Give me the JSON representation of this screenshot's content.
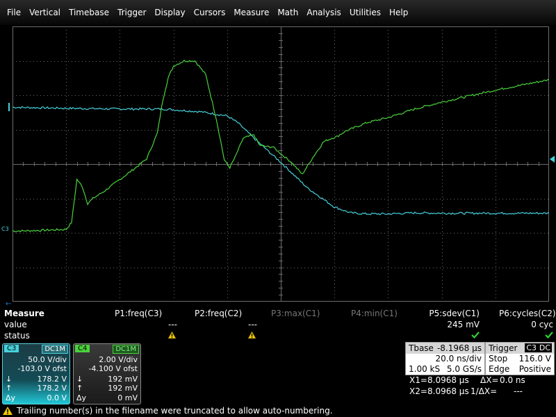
{
  "menu": [
    "File",
    "Vertical",
    "Timebase",
    "Trigger",
    "Display",
    "Cursors",
    "Measure",
    "Math",
    "Analysis",
    "Utilities",
    "Help"
  ],
  "colors": {
    "ch3": "#46d2dc",
    "ch4": "#4ad23c",
    "grid": "#6e6e6e",
    "accent_blue": "#1e78c8"
  },
  "markers": {
    "left_trace_label": "C3",
    "trigger_marker_icon": "triangle-left-icon",
    "time_marker_icon": "arrow-left-icon"
  },
  "measure": {
    "title": "Measure",
    "row_value": "value",
    "row_status": "status",
    "params": [
      {
        "label": "P1:freq(C3)",
        "value": "---",
        "status": "warning",
        "active": true
      },
      {
        "label": "P2:freq(C2)",
        "value": "---",
        "status": "warning",
        "active": true
      },
      {
        "label": "P3:max(C1)",
        "value": "",
        "status": "",
        "active": false
      },
      {
        "label": "P4:min(C1)",
        "value": "",
        "status": "",
        "active": false
      },
      {
        "label": "P5:sdev(C1)",
        "value": "245 mV",
        "status": "ok",
        "active": true
      },
      {
        "label": "P6:cycles(C2)",
        "value": "0 cyc",
        "status": "ok",
        "active": true
      }
    ]
  },
  "ch3": {
    "tag": "C3",
    "coupling": "DC1M",
    "scale": "50.0 V/div",
    "offset": "-103.0 V ofst",
    "down_sym": "↓",
    "down": "178.2 V",
    "up_sym": "↑",
    "up": "178.2 V",
    "dy_sym": "Δy",
    "dy": "0.0 V"
  },
  "ch4": {
    "tag": "C4",
    "coupling": "DC1M",
    "scale": "2.00 V/div",
    "offset": "-4.100 V ofst",
    "down_sym": "↓",
    "down": "192 mV",
    "up_sym": "↑",
    "up": "192 mV",
    "dy_sym": "Δy",
    "dy": "0 mV"
  },
  "timebase": {
    "label": "Tbase",
    "delay": "-8.1968 µs",
    "scale": "20.0 ns/div",
    "samples": "1.00 kS",
    "rate": "5.0 GS/s"
  },
  "trigger": {
    "label": "Trigger",
    "source": "C3",
    "coupling": "DC",
    "mode": "Stop",
    "level": "116.0 V",
    "type": "Edge",
    "slope": "Positive"
  },
  "cursors": {
    "x1_label": "X1=",
    "x1": "8.0968 µs",
    "dx_label": "ΔX=",
    "dx": "0.0 ns",
    "x2_label": "X2=",
    "x2": "8.0968 µs",
    "inv_label": "1/ΔX=",
    "inv": "---"
  },
  "status": {
    "message": "Trailing number(s) in the filename were truncated to allow auto-numbering."
  },
  "chart_data": {
    "type": "line",
    "grid": {
      "divisions_x": 10,
      "divisions_y": 8
    },
    "x_unit": "div",
    "y_unit": "div",
    "series": [
      {
        "name": "C3",
        "color": "#46d2dc",
        "x": [
          0,
          1,
          2,
          2.8,
          3.5,
          4.0,
          4.2,
          4.5,
          5.0,
          5.5,
          6.0,
          6.3,
          6.6,
          7.0,
          7.5,
          8.0,
          9.0,
          10.0
        ],
        "y": [
          1.65,
          1.62,
          1.6,
          1.6,
          1.52,
          1.4,
          1.2,
          0.75,
          0.05,
          -0.7,
          -1.25,
          -1.42,
          -1.45,
          -1.45,
          -1.42,
          -1.43,
          -1.43,
          -1.43
        ]
      },
      {
        "name": "C4",
        "color": "#4ad23c",
        "x": [
          0,
          0.5,
          1.0,
          1.1,
          1.2,
          1.3,
          1.4,
          1.5,
          1.7,
          2.0,
          2.3,
          2.5,
          2.7,
          2.8,
          2.9,
          3.0,
          3.2,
          3.4,
          3.6,
          3.8,
          3.95,
          4.05,
          4.15,
          4.3,
          4.5,
          4.6,
          4.75,
          4.85,
          5.0,
          5.2,
          5.4,
          5.6,
          5.8,
          5.95,
          6.05,
          6.2,
          6.6,
          7.0,
          7.5,
          8.0,
          9.0,
          10.0
        ],
        "y": [
          -1.95,
          -1.93,
          -1.9,
          -1.7,
          -0.45,
          -0.65,
          -1.15,
          -1.0,
          -0.8,
          -0.45,
          -0.1,
          0.15,
          0.9,
          1.85,
          2.5,
          2.85,
          3.0,
          3.0,
          2.6,
          1.3,
          0.1,
          -0.1,
          0.2,
          0.75,
          0.85,
          0.55,
          0.5,
          0.5,
          0.3,
          0.05,
          -0.3,
          0.2,
          0.65,
          0.75,
          0.8,
          0.95,
          1.2,
          1.35,
          1.6,
          1.8,
          2.15,
          2.45
        ]
      }
    ]
  }
}
